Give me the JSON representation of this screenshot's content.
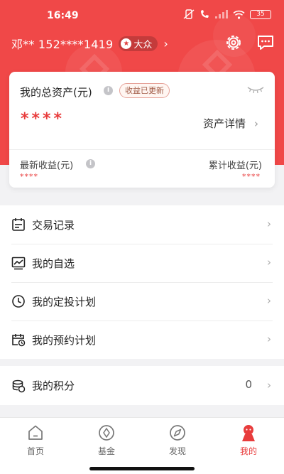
{
  "status_bar": {
    "time": "16:49",
    "battery": "35"
  },
  "user": {
    "name": "邓** 152****1419",
    "level": "大众"
  },
  "assets": {
    "title": "我的总资产(元)",
    "updated_badge": "收益已更新",
    "masked_total": "****",
    "detail_link": "资产详情",
    "recent_label": "最新收益(元)",
    "recent_value": "****",
    "cumulative_label": "累计收益(元)",
    "cumulative_value": "****"
  },
  "menu": [
    {
      "label": "交易记录",
      "icon": "calendar-icon"
    },
    {
      "label": "我的自选",
      "icon": "chart-icon"
    },
    {
      "label": "我的定投计划",
      "icon": "clock-icon"
    },
    {
      "label": "我的预约计划",
      "icon": "calendar-clock-icon"
    }
  ],
  "points": {
    "label": "我的积分",
    "value": "0",
    "icon": "coins-icon"
  },
  "tabs": [
    {
      "label": "首页",
      "icon": "home-icon"
    },
    {
      "label": "基金",
      "icon": "fund-icon"
    },
    {
      "label": "发现",
      "icon": "compass-icon"
    },
    {
      "label": "我的",
      "icon": "profile-icon",
      "active": true
    }
  ],
  "colors": {
    "brand": "#f04848",
    "accent_text": "#e83c3c"
  }
}
